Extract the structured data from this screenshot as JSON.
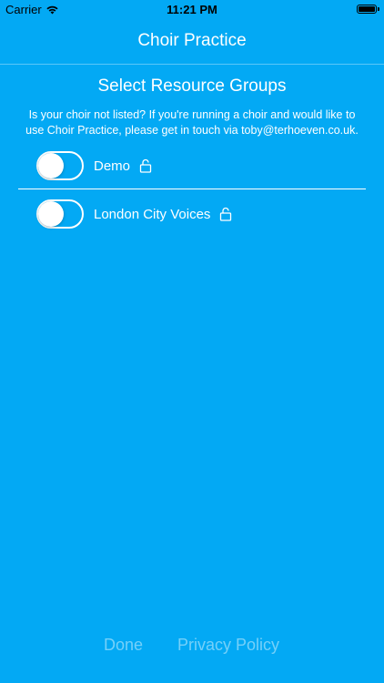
{
  "status_bar": {
    "carrier": "Carrier",
    "time": "11:21 PM",
    "wifi_icon": "wifi-icon",
    "battery_icon": "battery-icon"
  },
  "nav": {
    "title": "Choir Practice"
  },
  "section": {
    "title": "Select Resource Groups",
    "description": "Is your choir not listed? If you're running a choir and would like to use Choir Practice, please get in touch via toby@terhoeven.co.uk."
  },
  "groups": [
    {
      "label": "Demo",
      "enabled": false,
      "locked": true,
      "lock_icon": "lock-icon"
    },
    {
      "label": "London City Voices",
      "enabled": false,
      "locked": true,
      "lock_icon": "lock-icon"
    }
  ],
  "footer": {
    "done_label": "Done",
    "privacy_label": "Privacy Policy"
  },
  "colors": {
    "background": "#03a9f4",
    "text": "#ffffff"
  }
}
